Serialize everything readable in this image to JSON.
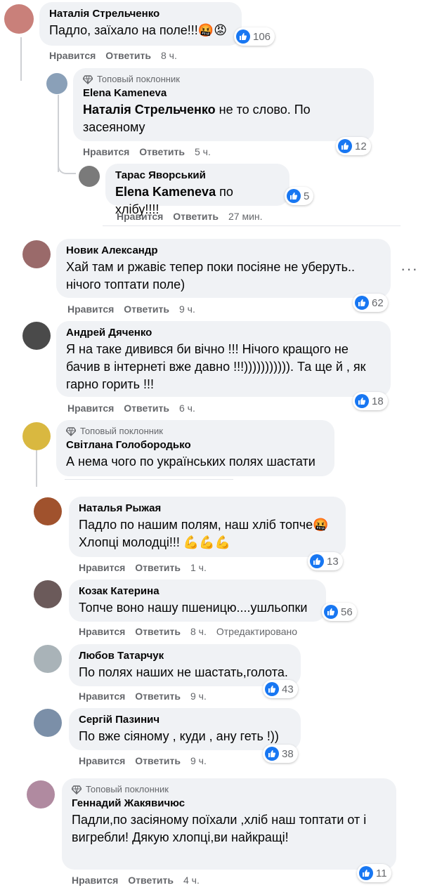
{
  "actions": {
    "like": "Нравится",
    "reply": "Ответить"
  },
  "badge_label": "Топовый поклонник",
  "comments": [
    {
      "author": "Наталія Стрельченко",
      "text": "Падло, заїхало на поле!!!🤬😡",
      "time": "8 ч.",
      "reactions": "106",
      "avatar_color": "#c9807a"
    },
    {
      "author": "Elena Kameneva",
      "mention": "Наталія Стрельченко",
      "text": " не то слово. По засеяному",
      "time": "5 ч.",
      "reactions": "12",
      "avatar_color": "#8aa0b8"
    },
    {
      "author": "Тарас Яворський",
      "mention": "Elena Kameneva",
      "text": " по хлібу!!!!",
      "time": "27 мин.",
      "reactions": "5",
      "avatar_color": "#7a7a7a"
    },
    {
      "author": "Новик Александр",
      "text": "Хай там и ржавіє тепер поки посіяне не уберуть.. нічого топтати поле)",
      "time": "9 ч.",
      "reactions": "62",
      "avatar_color": "#9a6a6a"
    },
    {
      "author": "Андрей Дяченко",
      "text": "Я на таке дивився би вічно !!! Нічого кращого не бачив в інтернеті вже давно !!!))))))))))). Та ще й , як гарно горить !!!",
      "time": "6 ч.",
      "reactions": "18",
      "avatar_color": "#4a4a4a"
    },
    {
      "author": "Світлана Голобородько",
      "text": "А нема чого по українських полях шастати",
      "avatar_color": "#d9b840"
    },
    {
      "author": "Наталья Рыжая",
      "text": "Падло по нашим полям, наш хліб топче🤬 Хлопці молодці!!! 💪💪💪",
      "time": "1 ч.",
      "reactions": "13",
      "avatar_color": "#a0522d"
    },
    {
      "author": "Козак Катерина",
      "text": "Топче воно нашу пшеницю....ушльопки",
      "time": "8 ч.",
      "edited": "Отредактировано",
      "reactions": "56",
      "avatar_color": "#6b5a5a"
    },
    {
      "author": "Любов Татарчук",
      "text": "По полях наших не шастать,голота.",
      "time": "9 ч.",
      "reactions": "43",
      "avatar_color": "#a9b3b8"
    },
    {
      "author": "Сергій Пазинич",
      "text": "По вже сіяному , куди , ану геть !))",
      "time": "9 ч.",
      "reactions": "38",
      "avatar_color": "#7b8fa8"
    },
    {
      "author": "Геннадий Жакявичюс",
      "text": "Падли,по засіяному поїхали ,хліб наш топтати от і вигребли! Дякую хлопці,ви найкращі!",
      "time": "4 ч.",
      "reactions": "11",
      "avatar_color": "#b08aa0"
    }
  ],
  "more_menu": "···",
  "colors": {
    "bubble": "#f0f2f5",
    "like_blue": "#1877f2",
    "meta_gray": "#65676b"
  }
}
